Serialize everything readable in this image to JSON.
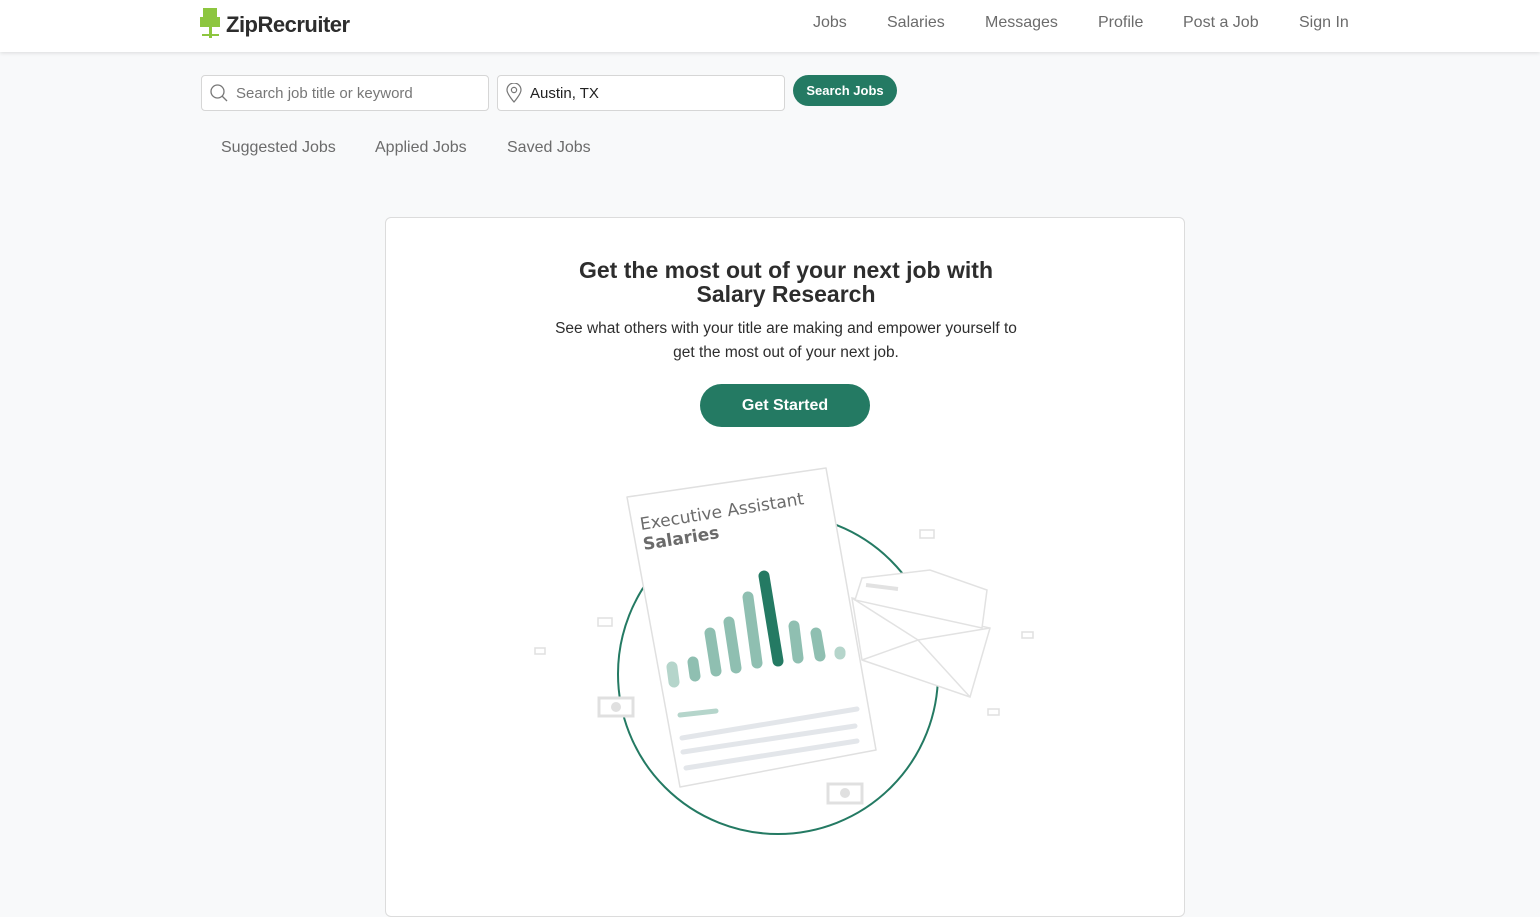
{
  "header": {
    "brand": "ZipRecruiter",
    "nav": [
      "Jobs",
      "Salaries",
      "Messages",
      "Profile",
      "Post a Job",
      "Sign In"
    ]
  },
  "search": {
    "keyword_placeholder": "Search job title or keyword",
    "location_value": "Austin, TX",
    "button": "Search Jobs"
  },
  "tabs": [
    "Suggested Jobs",
    "Applied Jobs",
    "Saved Jobs"
  ],
  "promo": {
    "title_line1": "Get the most out of your next job with",
    "title_line2": "Salary Research",
    "subtitle_line1": "See what others with your title are making and empower yourself to",
    "subtitle_line2": "get the most out of your next job.",
    "button": "Get Started",
    "illustration": {
      "title": "Executive Assistant",
      "subtitle": "Salaries"
    }
  },
  "colors": {
    "brand": "#247a63",
    "logo": "#8dc63f"
  }
}
